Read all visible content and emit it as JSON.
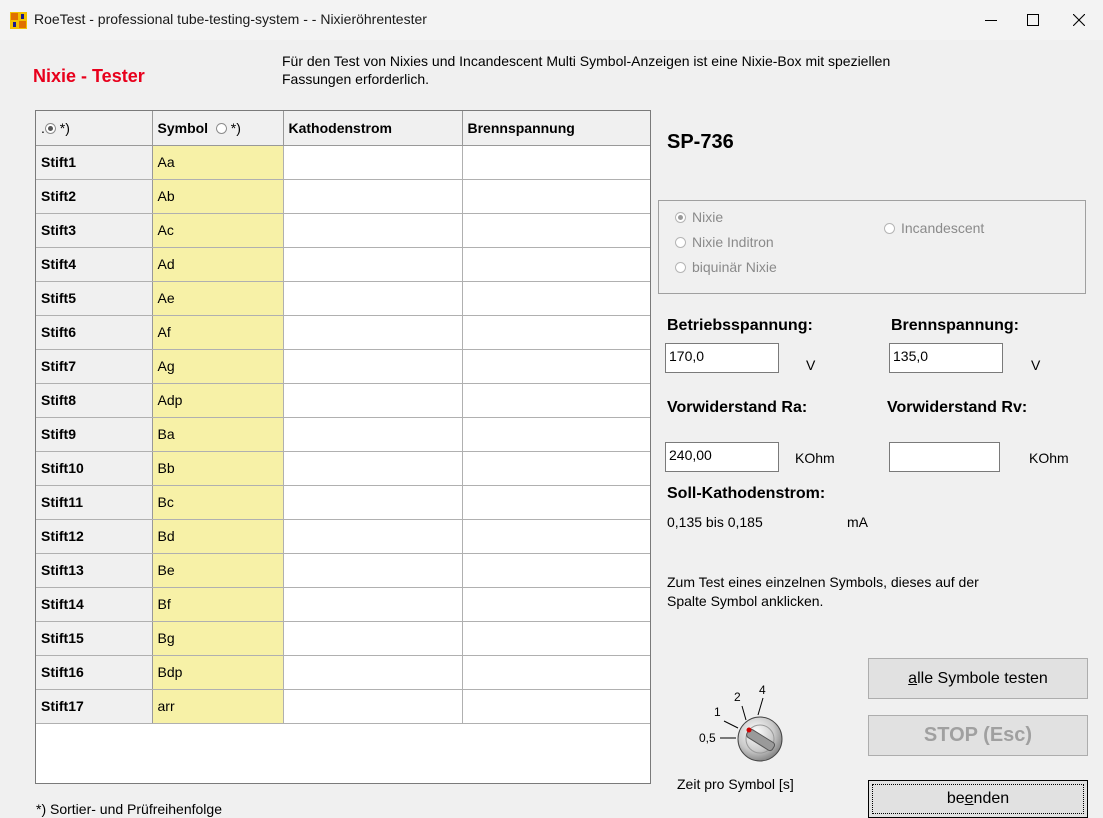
{
  "window": {
    "title": "RoeTest - professional tube-testing-system -  - Nixieröhrentester",
    "icon": "roetest-app-icon",
    "controls": [
      "minimize-icon",
      "maximize-icon",
      "close-icon"
    ]
  },
  "heading": "Nixie - Tester",
  "info_lines": [
    "Für den Test von Nixies und Incandescent Multi Symbol-Anzeigen ist eine Nixie-Box mit speziellen",
    "Fassungen erforderlich."
  ],
  "grid": {
    "columns": {
      "pin_prefix": ".",
      "pin_star": "*)",
      "symbol": "Symbol",
      "symbol_star": "*)",
      "cathode_current": "Kathodenstrom",
      "burn_voltage": "Brennspannung"
    },
    "rows": [
      {
        "pin": "Stift1",
        "symbol": "Aa",
        "current": "",
        "voltage": ""
      },
      {
        "pin": "Stift2",
        "symbol": "Ab",
        "current": "",
        "voltage": ""
      },
      {
        "pin": "Stift3",
        "symbol": "Ac",
        "current": "",
        "voltage": ""
      },
      {
        "pin": "Stift4",
        "symbol": "Ad",
        "current": "",
        "voltage": ""
      },
      {
        "pin": "Stift5",
        "symbol": "Ae",
        "current": "",
        "voltage": ""
      },
      {
        "pin": "Stift6",
        "symbol": "Af",
        "current": "",
        "voltage": ""
      },
      {
        "pin": "Stift7",
        "symbol": "Ag",
        "current": "",
        "voltage": ""
      },
      {
        "pin": "Stift8",
        "symbol": "Adp",
        "current": "",
        "voltage": ""
      },
      {
        "pin": "Stift9",
        "symbol": "Ba",
        "current": "",
        "voltage": ""
      },
      {
        "pin": "Stift10",
        "symbol": "Bb",
        "current": "",
        "voltage": ""
      },
      {
        "pin": "Stift11",
        "symbol": "Bc",
        "current": "",
        "voltage": ""
      },
      {
        "pin": "Stift12",
        "symbol": "Bd",
        "current": "",
        "voltage": ""
      },
      {
        "pin": "Stift13",
        "symbol": "Be",
        "current": "",
        "voltage": ""
      },
      {
        "pin": "Stift14",
        "symbol": "Bf",
        "current": "",
        "voltage": ""
      },
      {
        "pin": "Stift15",
        "symbol": "Bg",
        "current": "",
        "voltage": ""
      },
      {
        "pin": "Stift16",
        "symbol": "Bdp",
        "current": "",
        "voltage": ""
      },
      {
        "pin": "Stift17",
        "symbol": "arr",
        "current": "",
        "voltage": ""
      }
    ]
  },
  "footnote": "*) Sortier- und Prüfreihenfolge",
  "model": "SP-736",
  "type_options": {
    "nixie": "Nixie",
    "nixie_inditron": "Nixie Inditron",
    "biquinar": "biquinär Nixie",
    "incandescent": "Incandescent",
    "selected": "Nixie"
  },
  "operating_voltage": {
    "label": "Betriebsspannung:",
    "value": "170,0",
    "unit": "V"
  },
  "burn_voltage": {
    "label": "Brennspannung:",
    "value": "135,0",
    "unit": "V"
  },
  "series_resistor_ra": {
    "label": "Vorwiderstand Ra:",
    "value": "240,00",
    "unit": "KOhm"
  },
  "series_resistor_rv": {
    "label": "Vorwiderstand Rv:",
    "value": "",
    "unit": "KOhm"
  },
  "target_current": {
    "label": "Soll-Kathodenstrom:",
    "value": "0,135 bis 0,185",
    "unit": "mA"
  },
  "hint_lines": [
    "Zum Test eines einzelnen Symbols, dieses auf der",
    "Spalte Symbol anklicken."
  ],
  "knob": {
    "label": "Zeit pro Symbol [s]",
    "scale": [
      "0,5",
      "1",
      "2",
      "4"
    ],
    "selected": "0,5"
  },
  "buttons": {
    "test_all": "alle Symbole testen",
    "stop": "STOP (Esc)",
    "quit": "beenden"
  },
  "colors": {
    "heading": "#e8001c",
    "symbol_cell": "#f7f1a7"
  }
}
